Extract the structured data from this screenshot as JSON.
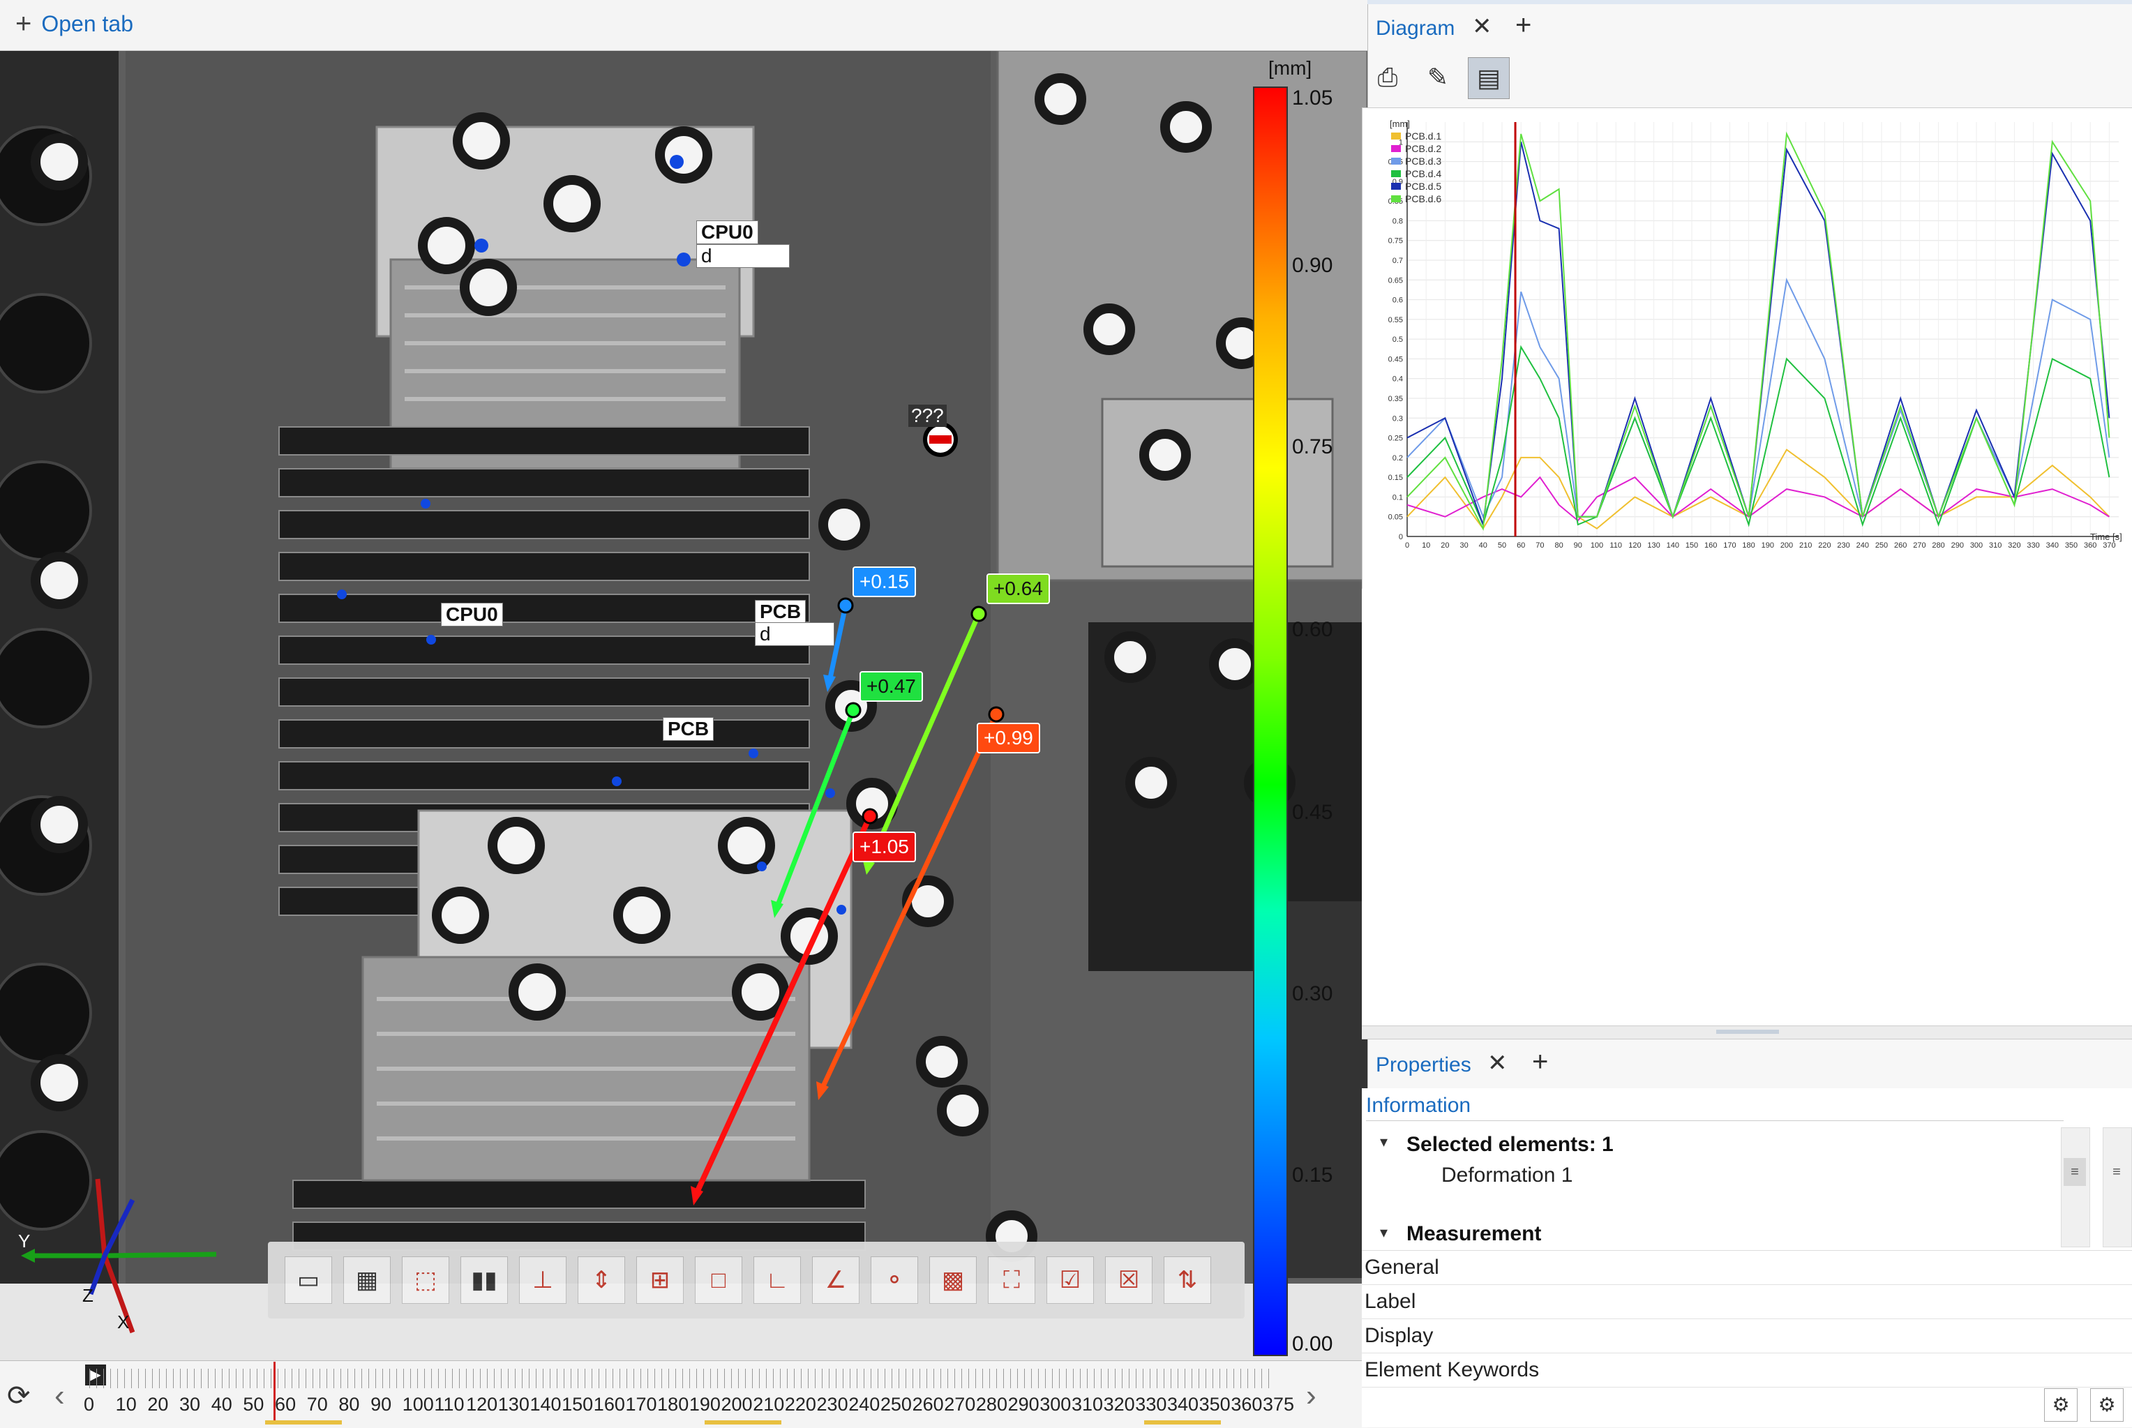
{
  "viewport": {
    "open_tab_label": "Open tab",
    "colorbar": {
      "unit": "[mm]",
      "ticks": [
        "1.05",
        "0.90",
        "0.75",
        "0.60",
        "0.45",
        "0.30",
        "0.15",
        "0.00"
      ]
    },
    "labels": {
      "cpu0_top": "CPU0",
      "cpu0_top_sub": "d",
      "cpu0_mid": "CPU0",
      "pcb_upper": "PCB",
      "pcb_upper_sub": "d",
      "pcb_lower": "PCB",
      "unknown": "???"
    },
    "values": {
      "v1": "+0.15",
      "v2": "+0.64",
      "v3": "+0.47",
      "v4": "+0.99",
      "v5": "+1.05"
    },
    "axes": {
      "y": "Y",
      "z": "Z",
      "x": "X"
    },
    "timeline": {
      "labels": [
        "0",
        "10",
        "20",
        "30",
        "40",
        "50",
        "60",
        "70",
        "80",
        "90",
        "100",
        "110",
        "120",
        "130",
        "140",
        "150",
        "160",
        "170",
        "180",
        "190",
        "200",
        "210",
        "220",
        "230",
        "240",
        "250",
        "260",
        "270",
        "280",
        "290",
        "300",
        "310",
        "320",
        "330",
        "340",
        "350",
        "360",
        "375"
      ]
    }
  },
  "diagram_panel": {
    "tab_label": "Diagram",
    "legend_unit": "[mm]",
    "x_axis_label": "Time [s]",
    "y_ticks": [
      "1",
      "0.95",
      "0.9",
      "0.85",
      "0.8",
      "0.75",
      "0.7",
      "0.65",
      "0.6",
      "0.55",
      "0.5",
      "0.45",
      "0.4",
      "0.35",
      "0.3",
      "0.25",
      "0.2",
      "0.15",
      "0.1",
      "0.05",
      "0"
    ],
    "x_ticks": [
      "0",
      "10",
      "20",
      "30",
      "40",
      "50",
      "60",
      "70",
      "80",
      "90",
      "100",
      "110",
      "120",
      "130",
      "140",
      "150",
      "160",
      "170",
      "180",
      "190",
      "200",
      "210",
      "220",
      "230",
      "240",
      "250",
      "260",
      "270",
      "280",
      "290",
      "300",
      "310",
      "320",
      "330",
      "340",
      "350",
      "360",
      "370"
    ],
    "series": [
      {
        "name": "PCB.d.1",
        "color": "#f0c030"
      },
      {
        "name": "PCB.d.2",
        "color": "#e020d0"
      },
      {
        "name": "PCB.d.3",
        "color": "#6f9be8"
      },
      {
        "name": "PCB.d.4",
        "color": "#20c040"
      },
      {
        "name": "PCB.d.5",
        "color": "#1a30b0"
      },
      {
        "name": "PCB.d.6",
        "color": "#60e040"
      }
    ]
  },
  "properties_panel": {
    "tab_label": "Properties",
    "section_title": "Information",
    "selected_label": "Selected elements:",
    "selected_count": "1",
    "selected_item": "Deformation 1",
    "measurement_label": "Measurement",
    "rows": [
      "General",
      "Label",
      "Display",
      "Element Keywords"
    ]
  },
  "chart_data": {
    "type": "line",
    "ylabel": "[mm]",
    "xlabel": "Time [s]",
    "xlim": [
      0,
      375
    ],
    "ylim": [
      0,
      1.05
    ],
    "x": [
      0,
      20,
      40,
      50,
      60,
      70,
      80,
      90,
      100,
      120,
      140,
      160,
      180,
      200,
      220,
      240,
      260,
      280,
      300,
      320,
      340,
      360,
      370
    ],
    "series": [
      {
        "name": "PCB.d.1",
        "values": [
          0.05,
          0.15,
          0.02,
          0.1,
          0.2,
          0.2,
          0.15,
          0.05,
          0.02,
          0.1,
          0.05,
          0.1,
          0.05,
          0.22,
          0.15,
          0.05,
          0.12,
          0.05,
          0.1,
          0.1,
          0.18,
          0.1,
          0.05
        ]
      },
      {
        "name": "PCB.d.2",
        "values": [
          0.08,
          0.05,
          0.1,
          0.12,
          0.1,
          0.15,
          0.08,
          0.04,
          0.1,
          0.15,
          0.05,
          0.12,
          0.05,
          0.12,
          0.1,
          0.05,
          0.12,
          0.05,
          0.12,
          0.1,
          0.12,
          0.08,
          0.05
        ]
      },
      {
        "name": "PCB.d.3",
        "values": [
          0.2,
          0.3,
          0.05,
          0.15,
          0.62,
          0.48,
          0.4,
          0.05,
          0.05,
          0.3,
          0.05,
          0.33,
          0.05,
          0.65,
          0.45,
          0.05,
          0.32,
          0.05,
          0.3,
          0.1,
          0.6,
          0.55,
          0.2
        ]
      },
      {
        "name": "PCB.d.4",
        "values": [
          0.15,
          0.25,
          0.03,
          0.2,
          0.48,
          0.4,
          0.3,
          0.03,
          0.05,
          0.3,
          0.05,
          0.3,
          0.03,
          0.45,
          0.35,
          0.03,
          0.3,
          0.03,
          0.3,
          0.08,
          0.45,
          0.4,
          0.15
        ]
      },
      {
        "name": "PCB.d.5",
        "values": [
          0.25,
          0.3,
          0.03,
          0.4,
          1.0,
          0.8,
          0.78,
          0.05,
          0.05,
          0.35,
          0.05,
          0.35,
          0.05,
          0.98,
          0.8,
          0.05,
          0.35,
          0.05,
          0.32,
          0.1,
          0.97,
          0.8,
          0.3
        ]
      },
      {
        "name": "PCB.d.6",
        "values": [
          0.1,
          0.2,
          0.02,
          0.45,
          1.02,
          0.85,
          0.88,
          0.05,
          0.05,
          0.33,
          0.05,
          0.33,
          0.05,
          1.02,
          0.82,
          0.05,
          0.33,
          0.05,
          0.3,
          0.08,
          1.0,
          0.85,
          0.25
        ]
      }
    ]
  }
}
